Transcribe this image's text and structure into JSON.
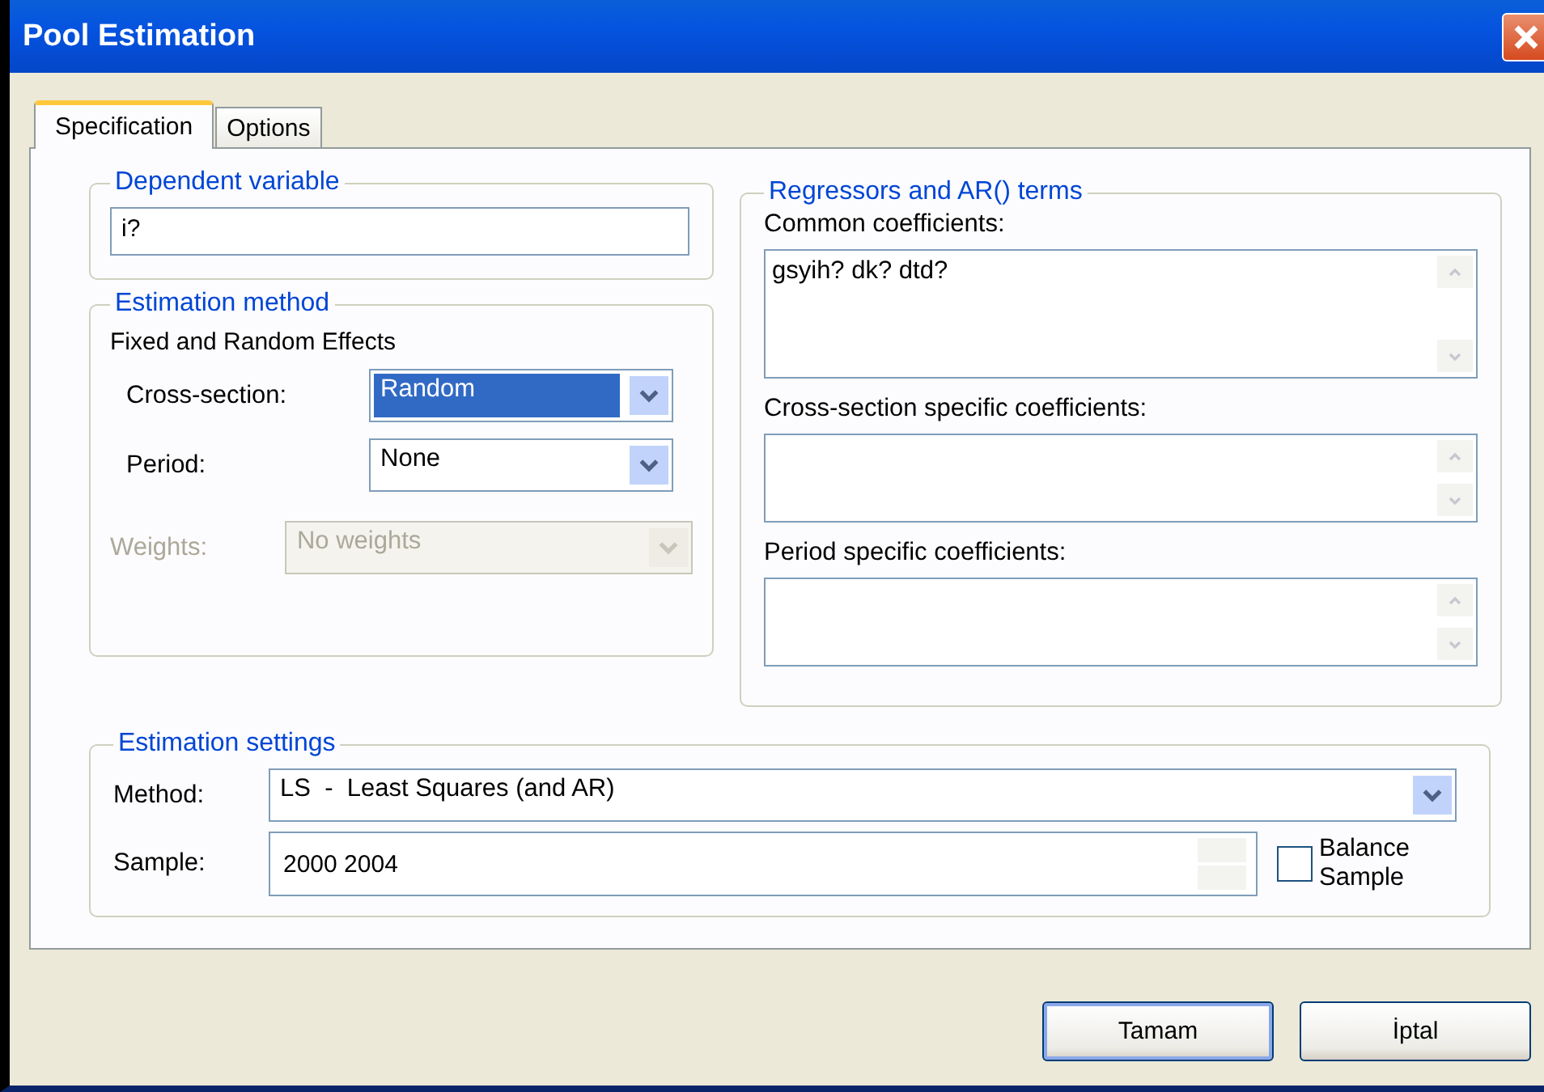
{
  "window": {
    "title": "Pool Estimation"
  },
  "tabs": [
    {
      "label": "Specification",
      "selected": true
    },
    {
      "label": "Options",
      "selected": false
    }
  ],
  "dependent": {
    "legend": "Dependent variable",
    "value": "i?"
  },
  "estimation_method": {
    "legend": "Estimation method",
    "heading": "Fixed and Random Effects",
    "fields": [
      {
        "label": "Cross-section:",
        "value": "Random",
        "focused": true,
        "disabled": false
      },
      {
        "label": "Period:",
        "value": "None",
        "focused": false,
        "disabled": false
      },
      {
        "label": "Weights:",
        "value": "No weights",
        "focused": false,
        "disabled": true
      }
    ]
  },
  "regressors": {
    "legend": "Regressors and AR() terms",
    "fields": [
      {
        "label": "Common coefficients:",
        "value": "gsyih? dk? dtd?"
      },
      {
        "label": "Cross-section specific coefficients:"
      },
      {
        "label": "Period specific coefficients:"
      }
    ]
  },
  "estimation_settings": {
    "legend": "Estimation settings",
    "method": {
      "label": "Method:",
      "value": "LS  -  Least Squares (and AR)"
    },
    "sample": {
      "label": "Sample:",
      "value": "2000 2004"
    },
    "balance": {
      "label": "Balance Sample",
      "checked": false
    }
  },
  "buttons": [
    {
      "label": "Tamam",
      "default": true
    },
    {
      "label": "İptal",
      "default": false
    }
  ]
}
